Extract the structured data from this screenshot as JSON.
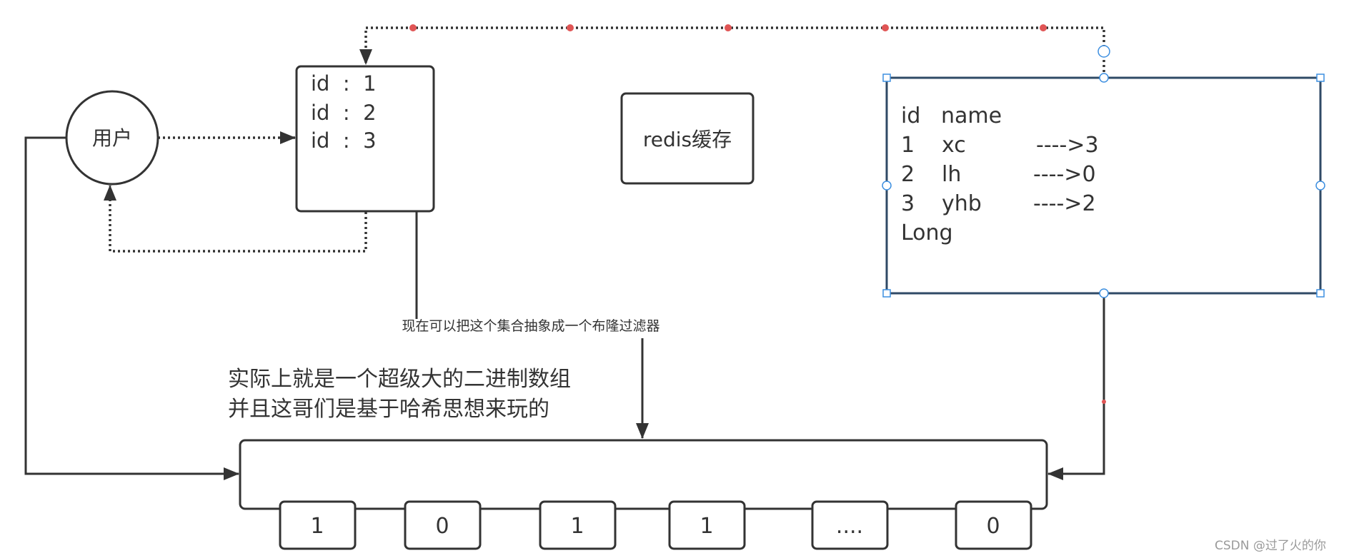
{
  "diagram": {
    "user_node": {
      "label": "用户"
    },
    "id_set_node": {
      "lines": [
        "id  :  1",
        "id  :  2",
        "id  :  3"
      ]
    },
    "redis_node": {
      "label": "redis缓存"
    },
    "db_table_node": {
      "header": "id   name",
      "rows": [
        {
          "id": "1",
          "name": "xc",
          "mapping": "---->3"
        },
        {
          "id": "2",
          "name": "lh",
          "mapping": "---->0"
        },
        {
          "id": "3",
          "name": "yhb",
          "mapping": "---->2"
        }
      ],
      "footer": "Long",
      "selected": true
    },
    "bloom_label": "现在可以把这个集合抽象成一个布隆过滤器",
    "explanation": [
      "实际上就是一个超级大的二进制数组",
      "并且这哥们是基于哈希思想来玩的"
    ],
    "bit_array": {
      "cells": [
        "1",
        "0",
        "1",
        "1",
        "....",
        "0"
      ]
    },
    "colors": {
      "stroke": "#333333",
      "selection": "#2f4a66",
      "handle": "#3d8fe0",
      "waypoint": "#e05555"
    }
  },
  "watermark": "CSDN @过了火的你"
}
